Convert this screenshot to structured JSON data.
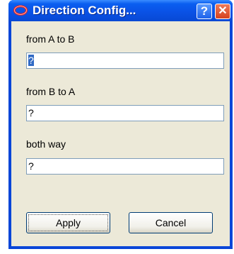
{
  "window": {
    "title": "Direction Config...",
    "help_label": "?",
    "close_label": "✕"
  },
  "form": {
    "fields": [
      {
        "label": "from A to B",
        "value": "?",
        "selected": true
      },
      {
        "label": "from B to A",
        "value": "?",
        "selected": false
      },
      {
        "label": "both way",
        "value": "?",
        "selected": false
      }
    ]
  },
  "buttons": {
    "apply_label": "Apply",
    "cancel_label": "Cancel"
  },
  "colors": {
    "titlebar": "#0a52e6",
    "client_bg": "#ece9d8",
    "close_button": "#d6421f",
    "selection": "#316ac5"
  },
  "icons": {
    "app": "oracle-icon"
  }
}
